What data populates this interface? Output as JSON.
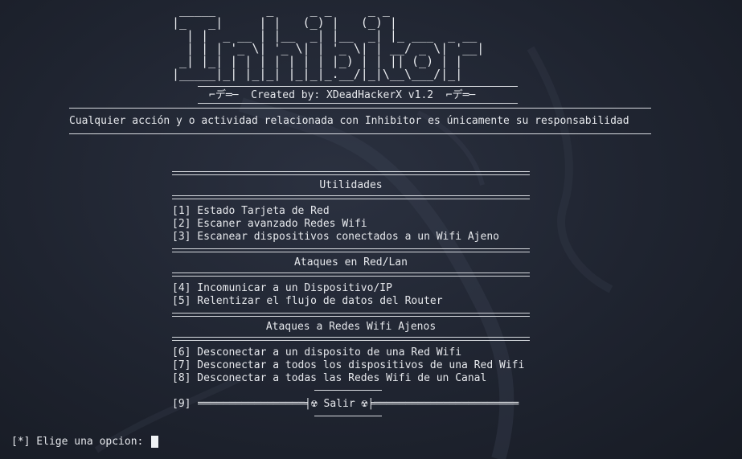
{
  "banner": {
    "ascii": " _____       _     _ _     _ _\n|_   _|     | |   (_) |   (_) |\n  | |  _ __ | |__  _| |__  _| |_ ___  _ __\n  | | | '_ \\| '_ \\| | '_ \\| | __/ _ \\| '__|\n _| |_| | | | | | | | |_) | | || (_) | |\n|_____|_| |_|_| |_|_|_.__/|_|\\__\\___/|_|",
    "credit": "⌐デ═─  Created by: XDeadHackerX v1.2  ⌐デ═─",
    "disclaimer": "Cualquier acción y o actividad relacionada con Inhibitor es únicamente su responsabilidad"
  },
  "menu": {
    "sections": [
      {
        "title": "Utilidades",
        "options": [
          "[1] Estado Tarjeta de Red",
          "[2] Escaner avanzado Redes Wifi",
          "[3] Escanear dispositivos conectados a un Wifi Ajeno"
        ]
      },
      {
        "title": "Ataques en Red/Lan",
        "options": [
          "[4] Incomunicar a un Dispositivo/IP",
          "[5] Relentizar el flujo de datos del Router"
        ]
      },
      {
        "title": "Ataques a Redes Wifi Ajenos",
        "options": [
          "[6] Desconectar a un disposito de una Red Wifi",
          "[7] Desconectar a todos los dispositivos de una Red Wifi",
          "[8] Desconectar a todas las Redes Wifi de un Canal"
        ]
      }
    ],
    "exit": {
      "number": "[9]",
      "label": "═════════════════╡☢ Salir ☢╞═══════════════════════"
    }
  },
  "prompt": {
    "text": "[*] Elige una opcion: "
  }
}
